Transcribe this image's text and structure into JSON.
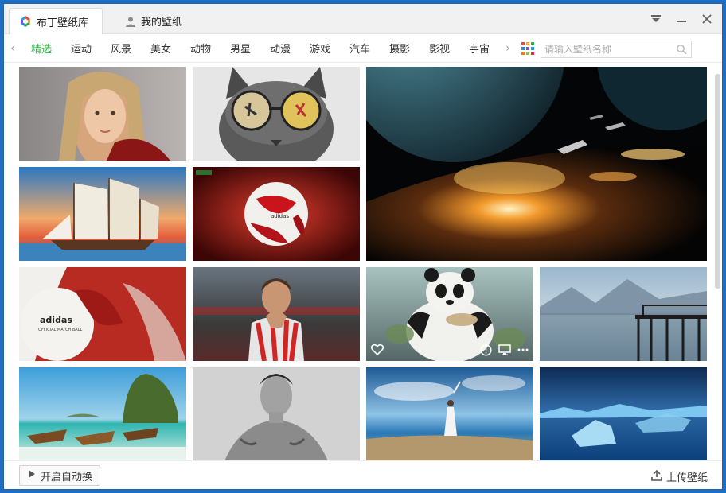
{
  "tabs": [
    {
      "label": "布丁壁纸库",
      "icon": "app-logo-icon",
      "active": true
    },
    {
      "label": "我的壁纸",
      "icon": "user-icon",
      "active": false
    }
  ],
  "window_controls": {
    "menu": "menu-dropdown-icon",
    "minimize": "minimize-icon",
    "close": "close-icon"
  },
  "categories": [
    "精选",
    "运动",
    "风景",
    "美女",
    "动物",
    "男星",
    "动漫",
    "游戏",
    "汽车",
    "摄影",
    "影视",
    "宇宙"
  ],
  "active_category": "精选",
  "accent_color": "#28b53f",
  "search": {
    "placeholder": "请输入壁纸名称"
  },
  "wallpapers": [
    {
      "id": "portrait-woman",
      "subject": "woman-portrait"
    },
    {
      "id": "cat-sunglasses",
      "subject": "cat-with-sunglasses"
    },
    {
      "id": "space-planet",
      "subject": "spaceships-over-planet"
    },
    {
      "id": "sailing-ship",
      "subject": "sailing-ship"
    },
    {
      "id": "soccer-ball-dark",
      "subject": "adidas-ball-red"
    },
    {
      "id": "adidas-ball",
      "subject": "adidas-match-ball"
    },
    {
      "id": "football-player",
      "subject": "stoke-football-player"
    },
    {
      "id": "kung-fu-panda",
      "subject": "panda-eating"
    },
    {
      "id": "lake-pier",
      "subject": "mountain-lake-pier"
    },
    {
      "id": "beach-boats",
      "subject": "tropical-beach-boats"
    },
    {
      "id": "man-portrait",
      "subject": "shirtless-man"
    },
    {
      "id": "beach-woman",
      "subject": "woman-on-beach"
    },
    {
      "id": "ice-lake",
      "subject": "blue-icebergs"
    }
  ],
  "hover_tile": {
    "actions": [
      "heart-icon",
      "info-icon",
      "monitor-icon",
      "more-icon"
    ]
  },
  "footer": {
    "auto_change_label": "开启自动换",
    "upload_label": "上传壁纸"
  }
}
